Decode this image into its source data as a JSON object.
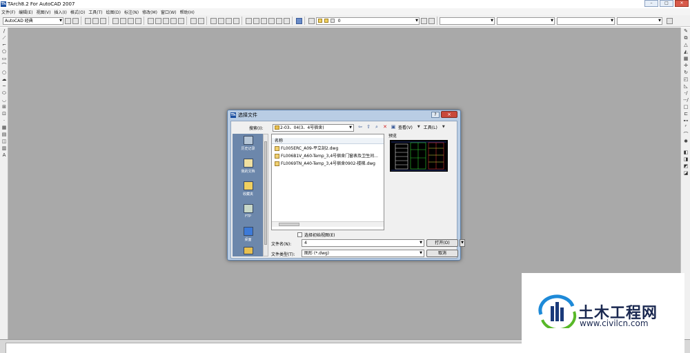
{
  "window": {
    "title": "TArch8.2 For AutoCAD 2007",
    "logo_text": "Th"
  },
  "menu": [
    "文件(F)",
    "编辑(E)",
    "视图(V)",
    "插入(I)",
    "格式(O)",
    "工具(T)",
    "绘图(D)",
    "标注(N)",
    "修改(M)",
    "窗口(W)",
    "帮助(H)"
  ],
  "toolbar": {
    "workspace": "AutoCAD 经典",
    "layer": "0"
  },
  "dialog": {
    "title": "选择文件",
    "logo_text": "Th",
    "help": "?",
    "close": "×",
    "search_label": "搜索(I):",
    "search_value": "2-03、04(3、4号宿舍)",
    "view_label": "查看(V)",
    "tools_label": "工具(L)",
    "column_name": "名称",
    "preview_label": "预览",
    "files": [
      "FL005ERC_A09-平立剖2.dwg",
      "FL006B1V_A60-Temp_3,4号宿舍门窗表及卫生间...",
      "FL0069TN_A40-Temp_3,4号宿舍0902-楼梯.dwg"
    ],
    "places": [
      "历史记录",
      "我的文档",
      "收藏夹",
      "FTP",
      "桌面"
    ],
    "checkbox_label": "选择初始视图(E)",
    "filename_label": "文件名(N):",
    "filename_value": "4",
    "filetype_label": "文件类型(T):",
    "filetype_value": "图形 (*.dwg)",
    "open_button": "打开(O)",
    "cancel_button": "取消"
  },
  "watermark": {
    "title": "土木工程网",
    "url": "www.civilcn.com"
  }
}
